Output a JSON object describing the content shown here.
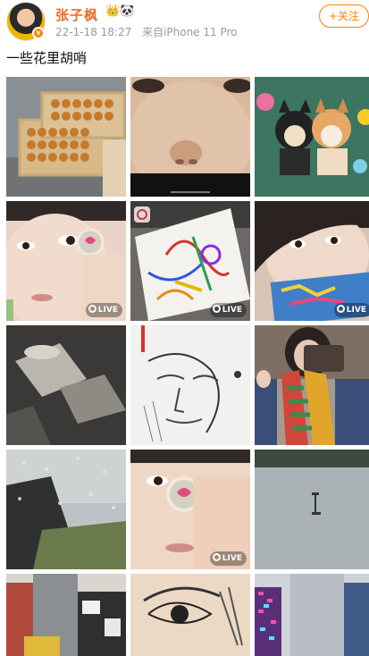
{
  "post": {
    "username": "张子枫",
    "name_icons": "👑🐼",
    "avatar_badge": "v",
    "date": "22-1-18 18:27",
    "source": "来自iPhone 11 Pro",
    "follow_label": "+关注",
    "text": "一些花里胡哨"
  },
  "live_label": "LIVE",
  "photos": [
    {
      "name": "photo-cakes-tray"
    },
    {
      "name": "photo-face-closeup"
    },
    {
      "name": "photo-shiba-dogs"
    },
    {
      "name": "photo-girl-eye-sticker",
      "live": true
    },
    {
      "name": "photo-doodle-notebook",
      "live": true
    },
    {
      "name": "photo-girl-card",
      "live": true
    },
    {
      "name": "photo-light-shadow"
    },
    {
      "name": "photo-sketch-face"
    },
    {
      "name": "photo-mirror-selfie"
    },
    {
      "name": "photo-rainy-window"
    },
    {
      "name": "photo-girl-eye-sticker-2",
      "live": true
    },
    {
      "name": "photo-river-view"
    },
    {
      "name": "photo-street-scene"
    },
    {
      "name": "photo-sketch-eye"
    },
    {
      "name": "photo-light-wall"
    }
  ]
}
